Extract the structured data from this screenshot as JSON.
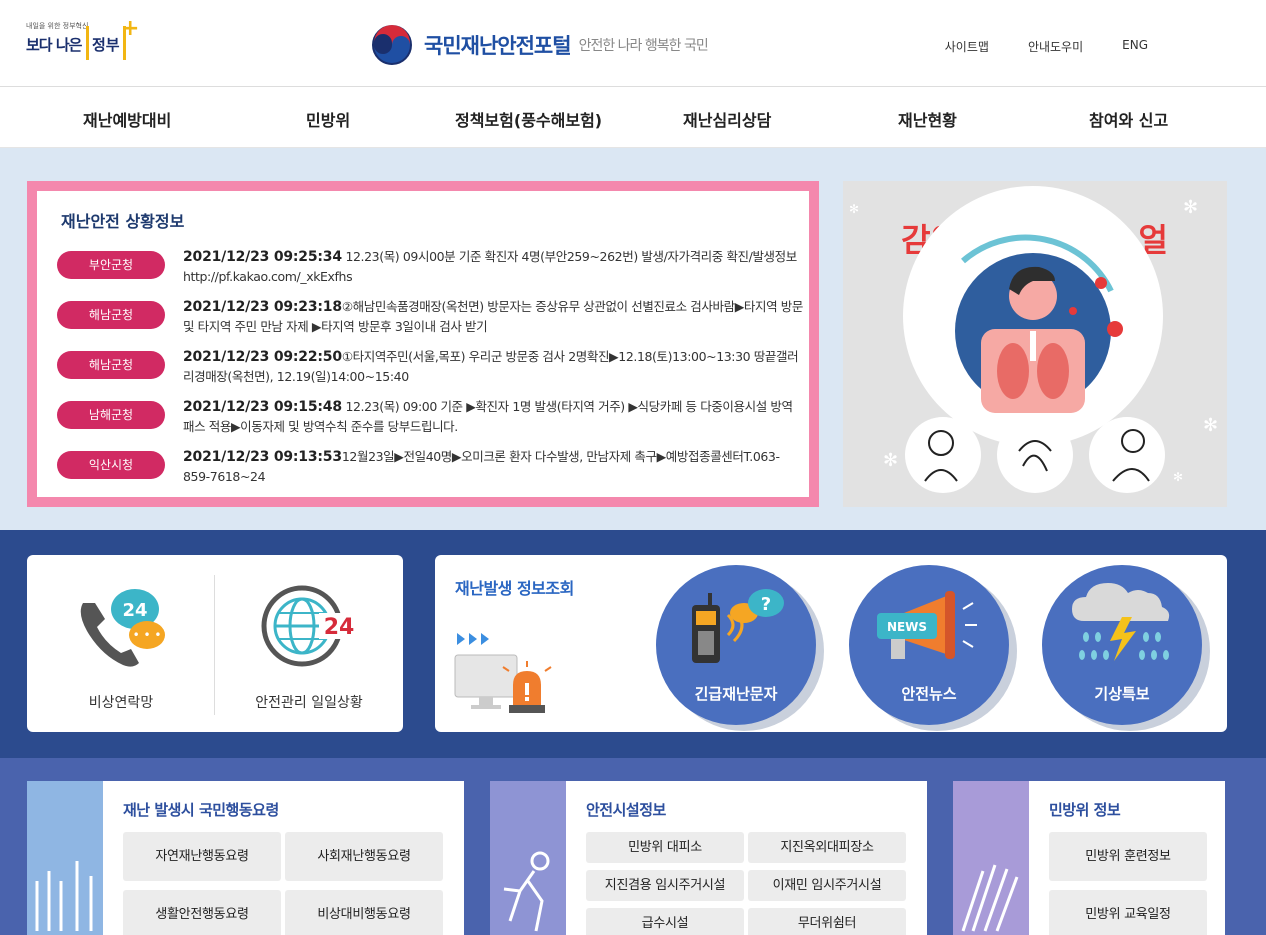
{
  "header": {
    "gov_logo_small": "내일을 위한 정부혁신",
    "gov_logo_big": "보다 나은",
    "gov_logo_gov": "정부",
    "portal_name": "국민재난안전포털",
    "portal_slogan": "안전한 나라 행복한 국민",
    "util_links": [
      "사이트맵",
      "안내도우미",
      "ENG"
    ]
  },
  "nav": {
    "items": [
      "재난예방대비",
      "민방위",
      "정책보험(풍수해보험)",
      "재난심리상담",
      "재난현황",
      "참여와 신고"
    ]
  },
  "situation": {
    "title": "재난안전 상황정보",
    "rows": [
      {
        "agency": "부안군청",
        "datetime": "2021/12/23 09:25:34",
        "text": " 12.23(목) 09시00분 기준 확진자 4명(부안259~262번) 발생/자가격리중 확진/발생정보 http://pf.kakao.com/_xkExfhs"
      },
      {
        "agency": "해남군청",
        "datetime": "2021/12/23 09:23:18",
        "text": "②해남민속품경매장(옥천면) 방문자는 증상유무 상관없이 선별진료소 검사바람▶타지역 방문 및 타지역 주민 만남 자제 ▶타지역 방문후 3일이내 검사 받기"
      },
      {
        "agency": "해남군청",
        "datetime": "2021/12/23 09:22:50",
        "text": "①타지역주민(서울,목포) 우리군 방문중 검사 2명확진▶12.18(토)13:00~13:30 땅끝갤러리경매장(옥천면), 12.19(일)14:00~15:40"
      },
      {
        "agency": "남해군청",
        "datetime": "2021/12/23 09:15:48",
        "text": " 12.23(목) 09:00 기준 ▶확진자 1명 발생(타지역 거주) ▶식당카페 등 다중이용시설 방역패스 적용▶이동자제 및 방역수칙 준수를 당부드립니다."
      },
      {
        "agency": "익산시청",
        "datetime": "2021/12/23 09:13:53",
        "text": "12월23일▶전일40명▶오미크론 환자 다수발생, 만남자제 촉구▶예방접종콜센터T.063-859-7618~24"
      }
    ]
  },
  "banner": {
    "title": "감염병 예방 매뉴얼"
  },
  "quick": {
    "items": [
      "비상연락망",
      "안전관리 일일상황"
    ],
    "badge": "24"
  },
  "inquiry": {
    "title": "재난발생 정보조회",
    "buttons": [
      "긴급재난문자",
      "안전뉴스",
      "기상특보"
    ],
    "news_text": "NEWS"
  },
  "panels": [
    {
      "title": "재난 발생시 국민행동요령",
      "buttons": [
        "자연재난행동요령",
        "사회재난행동요령",
        "생활안전행동요령",
        "비상대비행동요령"
      ]
    },
    {
      "title": "안전시설정보",
      "buttons": [
        "민방위 대피소",
        "지진옥외대피장소",
        "지진겸용 임시주거시설",
        "이재민 임시주거시설",
        "급수시설",
        "무더위쉼터"
      ]
    },
    {
      "title": "민방위 정보",
      "buttons": [
        "민방위 훈련정보",
        "민방위 교육일정"
      ]
    }
  ],
  "colors": {
    "accent_pink": "#d12a63",
    "frame_pink": "#f488ad",
    "navy": "#2c4b8e",
    "circle_blue": "#4a6fbf"
  }
}
